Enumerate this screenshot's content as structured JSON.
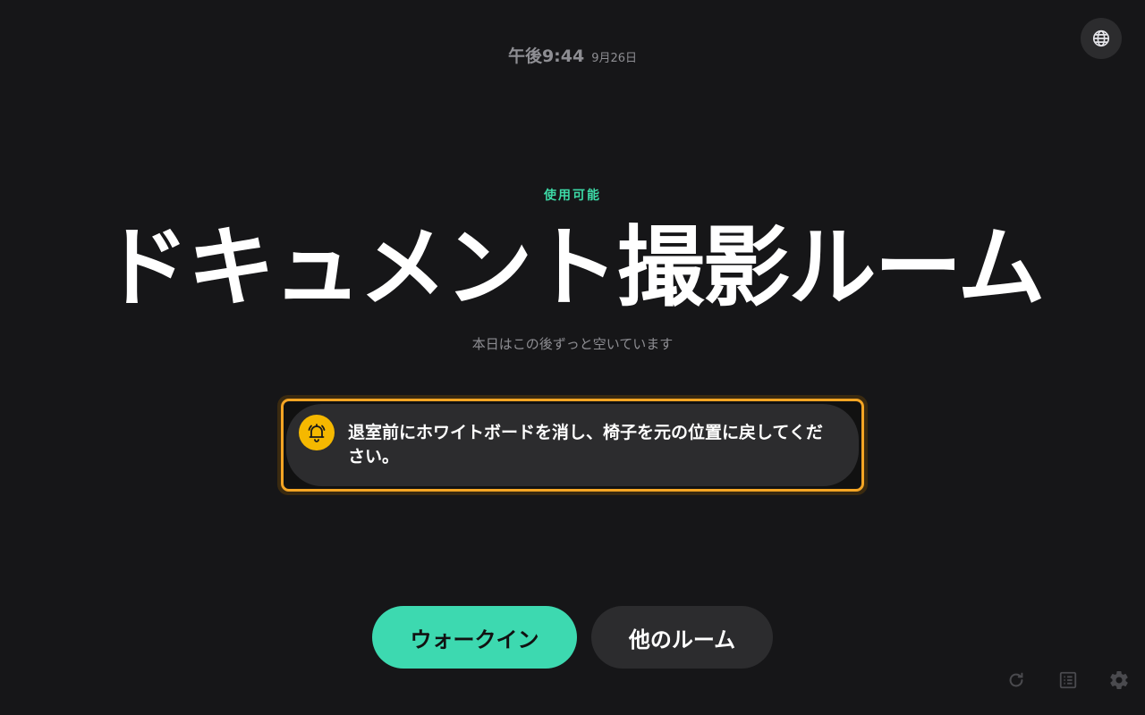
{
  "header": {
    "time": "午後9:44",
    "date": "9月26日",
    "language_icon": "globe-icon"
  },
  "room": {
    "status": "使用可能",
    "name": "ドキュメント撮影ルーム",
    "availability": "本日はこの後ずっと空いています"
  },
  "notice": {
    "icon": "bell-icon",
    "message": "退室前にホワイトボードを消し、椅子を元の位置に戻してください。"
  },
  "actions": {
    "walk_in_label": "ウォークイン",
    "other_rooms_label": "他のルーム"
  },
  "toolbar": {
    "icons": [
      "refresh-icon",
      "list-icon",
      "gear-icon"
    ]
  },
  "colors": {
    "background": "#161618",
    "accent_green": "#3dd9b0",
    "status_green": "#3dd9a6",
    "notice_border": "#f5a524",
    "bell_yellow": "#f5b800",
    "muted_text": "#8e8e93",
    "surface": "#2c2c2e"
  }
}
